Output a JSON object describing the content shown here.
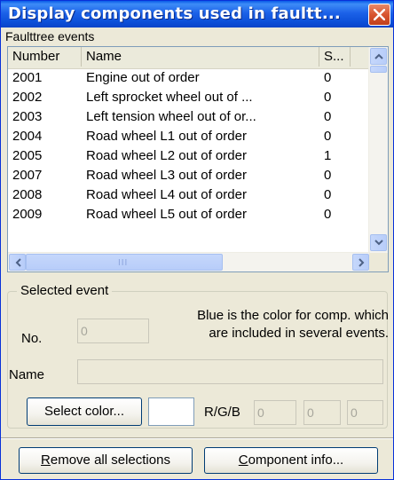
{
  "window": {
    "title": "Display components used in faultt...",
    "close_label": "close"
  },
  "events_group": {
    "label": "Faulttree events",
    "columns": [
      "Number",
      "Name",
      "S..."
    ],
    "rows": [
      {
        "number": "2001",
        "name": "Engine out of order",
        "s": "0"
      },
      {
        "number": "2002",
        "name": "Left sprocket wheel out of ...",
        "s": "0"
      },
      {
        "number": "2003",
        "name": "Left tension wheel out of or...",
        "s": "0"
      },
      {
        "number": "2004",
        "name": "Road wheel L1 out of order",
        "s": "0"
      },
      {
        "number": "2005",
        "name": "Road wheel L2 out of order",
        "s": "1"
      },
      {
        "number": "2007",
        "name": "Road wheel L3 out of order",
        "s": "0"
      },
      {
        "number": "2008",
        "name": "Road wheel L4 out of order",
        "s": "0"
      },
      {
        "number": "2009",
        "name": "Road wheel L5 out of order",
        "s": "0"
      }
    ],
    "scrollbar_grip": "III"
  },
  "selected_event": {
    "legend": "Selected event",
    "no_label": "No.",
    "no_value": "0",
    "info_line1": "Blue is the color for comp. which",
    "info_line2": "are included in several events.",
    "name_label": "Name",
    "name_value": "",
    "select_color_label": "Select color...",
    "rgb_label": "R/G/B",
    "r_value": "0",
    "g_value": "0",
    "b_value": "0"
  },
  "footer": {
    "remove_first": "R",
    "remove_rest": "emove all selections",
    "info_first": "C",
    "info_rest": "omponent info..."
  },
  "colors": {
    "titlebar": "#0c4fd8",
    "close_button": "#d8542e",
    "window_bg": "#ece9d8"
  }
}
